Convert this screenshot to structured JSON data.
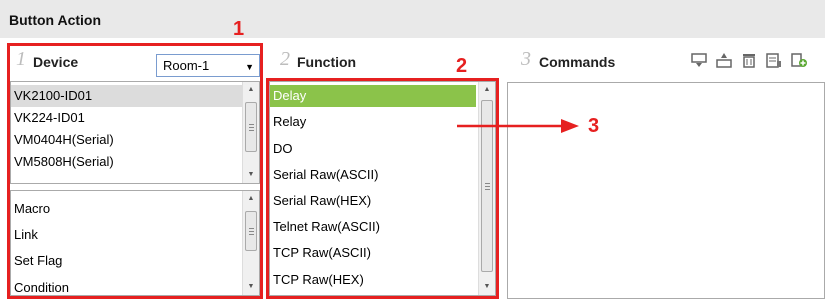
{
  "title": "Button Action",
  "device": {
    "step": "1",
    "label": "Device",
    "room_selected": "Room-1",
    "devices": [
      "VK2100-ID01",
      "VK224-ID01",
      "VM0404H(Serial)",
      "VM5808H(Serial)"
    ],
    "macros": [
      "Macro",
      "Link",
      "Set Flag",
      "Condition"
    ]
  },
  "function": {
    "step": "2",
    "label": "Function",
    "items": [
      "Delay",
      "Relay",
      "DO",
      "Serial Raw(ASCII)",
      "Serial Raw(HEX)",
      "Telnet Raw(ASCII)",
      "TCP Raw(ASCII)",
      "TCP Raw(HEX)"
    ]
  },
  "commands": {
    "step": "3",
    "label": "Commands",
    "toolbar_icons": [
      "move-down-icon",
      "move-up-icon",
      "delete-icon",
      "edit-icon",
      "add-icon"
    ]
  },
  "annotations": {
    "one": "1",
    "two": "2",
    "three": "3"
  },
  "colors": {
    "highlight": "#8bc34a",
    "annotation": "#e62020"
  }
}
